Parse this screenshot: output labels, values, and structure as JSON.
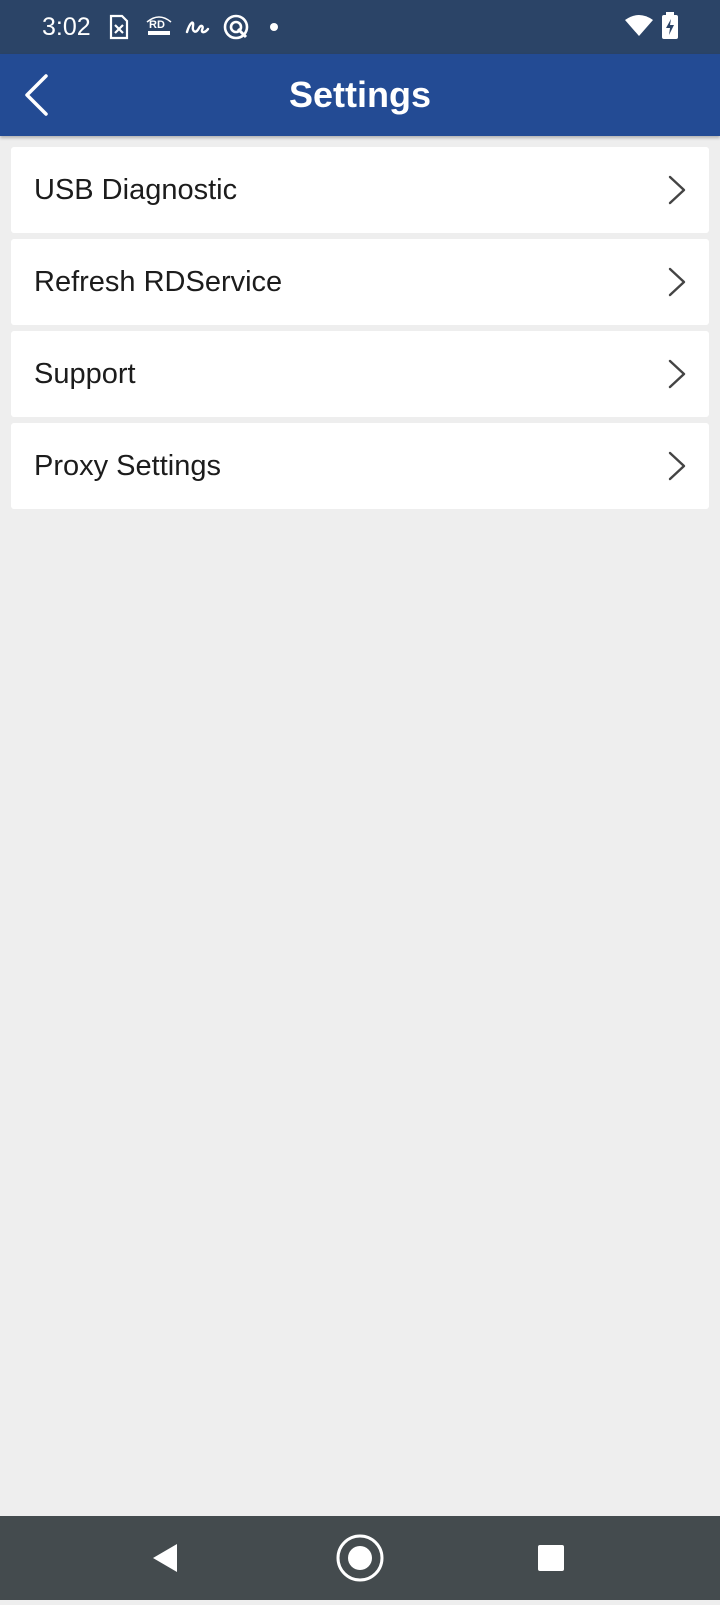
{
  "status_bar": {
    "time": "3:02",
    "notification_icons": [
      "sim-card-icon",
      "rd-service-icon",
      "signature-icon",
      "scan-icon",
      "notification-dot-icon"
    ],
    "system_icons": [
      "wifi-icon",
      "battery-charging-icon"
    ],
    "background_color": "#2b4467"
  },
  "app_bar": {
    "title": "Settings",
    "back_icon": "chevron-left-icon",
    "background_color": "#234b94"
  },
  "settings": {
    "items": [
      {
        "label": "USB Diagnostic",
        "icon": "chevron-right-icon"
      },
      {
        "label": "Refresh RDService",
        "icon": "chevron-right-icon"
      },
      {
        "label": "Support",
        "icon": "chevron-right-icon"
      },
      {
        "label": "Proxy Settings",
        "icon": "chevron-right-icon"
      }
    ]
  },
  "nav_bar": {
    "buttons": [
      "back-triangle-icon",
      "home-circle-icon",
      "recents-square-icon"
    ],
    "background_color": "#444b4e"
  },
  "colors": {
    "page_background": "#eeeeee",
    "card_background": "#ffffff",
    "text_primary": "#1c1c1c",
    "chevron": "#444444"
  }
}
